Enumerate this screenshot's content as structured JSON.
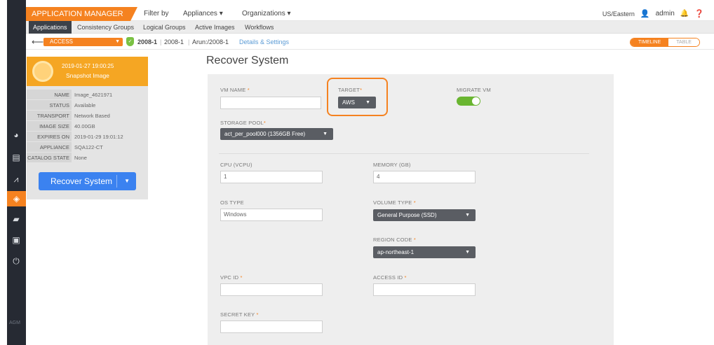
{
  "rail": {
    "icons": [
      "dashboard-icon",
      "database-icon",
      "chart-icon",
      "shield-icon",
      "copy-icon",
      "monitor-icon",
      "power-icon"
    ],
    "footer": "AGM"
  },
  "topbar": {
    "app_title": "APPLICATION MANAGER",
    "filter_by": "Filter by",
    "appliances": "Appliances ▾",
    "organizations": "Organizations ▾",
    "timezone": "US/Eastern",
    "user": "admin"
  },
  "subnav": {
    "tabs": [
      "Applications",
      "Consistency Groups",
      "Logical Groups",
      "Active Images",
      "Workflows"
    ]
  },
  "breadcrumbs": {
    "back": "⟵",
    "access_label": "ACCESS",
    "item1": "2008-1",
    "item2": "2008-1",
    "item3": "Arun:/2008-1",
    "link": "Details & Settings"
  },
  "view_toggle": {
    "timeline": "TIMELINE",
    "table": "TABLE"
  },
  "snapshot": {
    "date": "2019-01-27 19:00:25",
    "type": "Snapshot Image",
    "fields": [
      {
        "k": "NAME",
        "v": "Image_4621971"
      },
      {
        "k": "STATUS",
        "v": "Available"
      },
      {
        "k": "TRANSPORT",
        "v": "Network Based"
      },
      {
        "k": "IMAGE SIZE",
        "v": "40.00GB"
      },
      {
        "k": "EXPIRES ON",
        "v": "2019-01-29 19:01:12"
      },
      {
        "k": "APPLIANCE",
        "v": "SQA122-CT"
      },
      {
        "k": "CATALOG STATE",
        "v": "None"
      }
    ],
    "recover_button": "Recover System"
  },
  "form": {
    "title": "Recover System",
    "vm_name_label": "VM NAME",
    "vm_name_value": "",
    "target_label": "TARGET",
    "target_value": "AWS",
    "migrate_label": "MIGRATE VM",
    "migrate_on": true,
    "storage_pool_label": "STORAGE POOL",
    "storage_pool_value": "act_per_pool000 (1356GB Free)",
    "cpu_label": "CPU (VCPU)",
    "cpu_value": "1",
    "memory_label": "MEMORY (GB)",
    "memory_value": "4",
    "os_type_label": "OS TYPE",
    "os_type_value": "Windows",
    "volume_type_label": "VOLUME TYPE",
    "volume_type_value": "General Purpose (SSD)",
    "region_code_label": "REGION CODE",
    "region_code_value": "ap-northeast-1",
    "vpc_id_label": "VPC ID",
    "access_id_label": "ACCESS ID",
    "secret_key_label": "SECRET KEY",
    "req": "*"
  },
  "colors": {
    "accent": "#f58220",
    "primary": "#3b82f0",
    "toggle_on": "#69b530",
    "rail": "#262a33"
  }
}
